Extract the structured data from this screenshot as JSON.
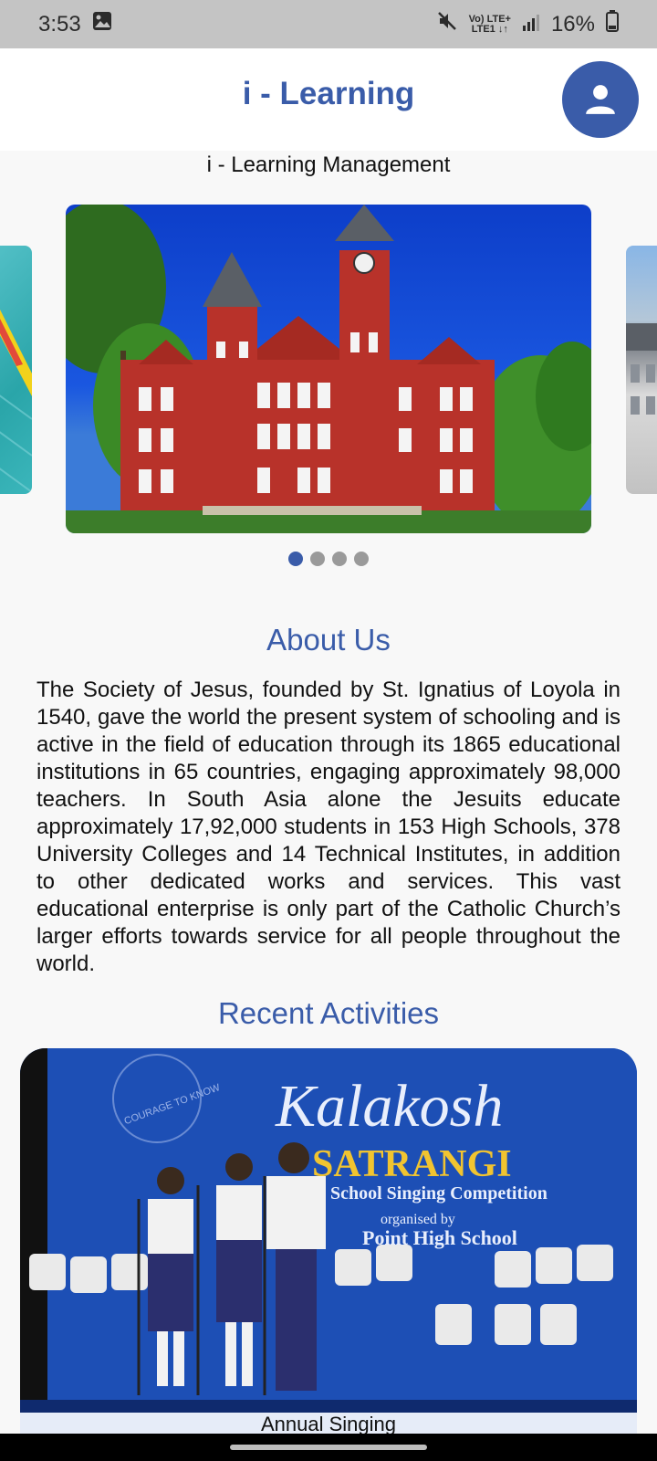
{
  "status_bar": {
    "time": "3:53",
    "network_top": "Vo) LTE+",
    "network_bottom": "LTE1 ↓↑",
    "battery": "16%",
    "icons": [
      "image-icon",
      "mute-icon",
      "signal-icon",
      "battery-icon"
    ]
  },
  "app_bar": {
    "title": "i - Learning",
    "profile_icon": "person-icon",
    "accent_color": "#3a5ca9"
  },
  "subtitle": "i - Learning Management",
  "carousel": {
    "slides": [
      "pool-image",
      "university-building-image",
      "building-image",
      "slide-4"
    ],
    "active_index": 0,
    "dot_count": 4
  },
  "about": {
    "title": "About Us",
    "text": "The Society of Jesus, founded by St. Ignatius of Loyola in 1540, gave the world the present system of schooling and is active in the field of education through its 1865 educational institutions in 65 countries, engaging approximately 98,000 teachers. In South Asia alone the Jesuits educate approximately 17,92,000 students in 153 High Schools, 378 University Colleges and 14 Technical Institutes, in addition to other dedicated works and services. This vast educational enterprise is only part of the Catholic Church’s larger efforts towards service for all people throughout the world."
  },
  "recent_activities": {
    "title": "Recent Activities",
    "card": {
      "banner_brand": "Kalakosh",
      "banner_title": "SATRANGI",
      "banner_subtitle": "School Singing Competition",
      "banner_line": "organised by",
      "banner_school": "Point High School",
      "badge_text": "COURAGE TO KNOW",
      "caption": "Annual Singing"
    }
  }
}
